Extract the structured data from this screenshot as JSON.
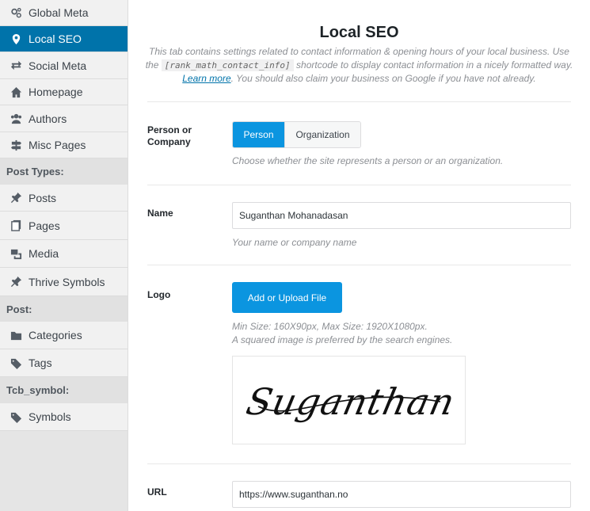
{
  "sidebar": {
    "items": [
      {
        "label": "Global Meta",
        "icon": "gears-icon"
      },
      {
        "label": "Local SEO",
        "icon": "location-pin-icon",
        "active": true
      },
      {
        "label": "Social Meta",
        "icon": "share-arrows-icon"
      },
      {
        "label": "Homepage",
        "icon": "home-icon"
      },
      {
        "label": "Authors",
        "icon": "users-icon"
      },
      {
        "label": "Misc Pages",
        "icon": "signpost-icon"
      }
    ],
    "headings": {
      "post_types": "Post Types:",
      "post": "Post:",
      "tcb_symbol": "Tcb_symbol:"
    },
    "post_type_items": [
      {
        "label": "Posts",
        "icon": "pushpin-icon"
      },
      {
        "label": "Pages",
        "icon": "pages-icon"
      },
      {
        "label": "Media",
        "icon": "media-icon"
      },
      {
        "label": "Thrive Symbols",
        "icon": "pushpin-icon"
      }
    ],
    "post_items": [
      {
        "label": "Categories",
        "icon": "folder-icon"
      },
      {
        "label": "Tags",
        "icon": "tag-icon"
      }
    ],
    "tcb_items": [
      {
        "label": "Symbols",
        "icon": "tag-icon"
      }
    ]
  },
  "main": {
    "title": "Local SEO",
    "description": {
      "part1": "This tab contains settings related to contact information & opening hours of your local business. Use the",
      "code": "[rank_math_contact_info]",
      "part2": "shortcode to display contact information in a nicely formatted way.",
      "link": "Learn more",
      "part3": ". You should also claim your business on Google if you have not already."
    },
    "person_company": {
      "label_line1": "Person or",
      "label_line2": "Company",
      "options": [
        "Person",
        "Organization"
      ],
      "selected": "Person",
      "description": "Choose whether the site represents a person or an organization."
    },
    "name": {
      "label": "Name",
      "value": "Suganthan Mohanadasan",
      "description": "Your name or company name"
    },
    "logo": {
      "label": "Logo",
      "button": "Add or Upload File",
      "size_note": "Min Size: 160X90px, Max Size: 1920X1080px.",
      "square_note": "A squared image is preferred by the search engines.",
      "signature": "Suganthan"
    },
    "url": {
      "label": "URL",
      "value": "https://www.suganthan.no"
    }
  },
  "colors": {
    "accent": "#0b95e0",
    "active_nav": "#0073aa",
    "link": "#0073aa"
  }
}
